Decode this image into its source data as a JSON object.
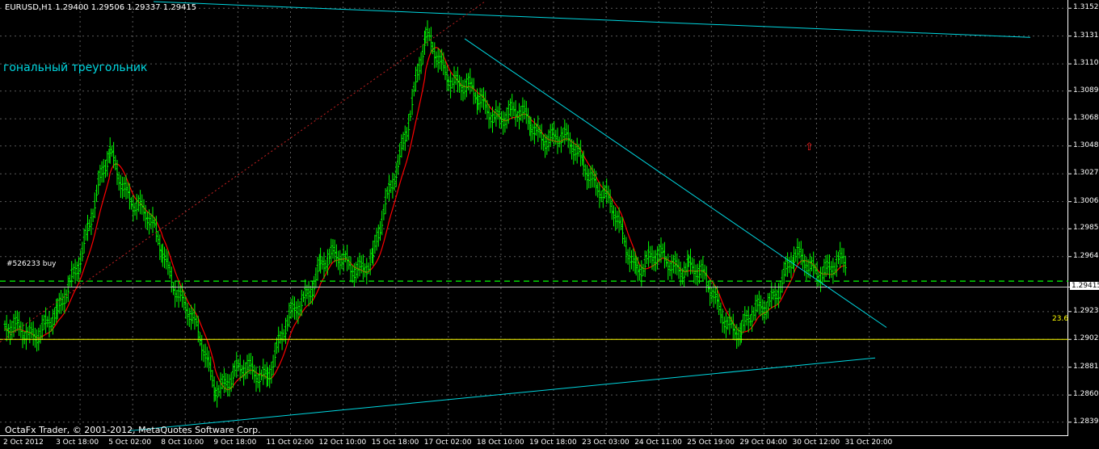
{
  "header": {
    "symbol_info": "EURUSD,H1  1.29400 1.29506 1.29337 1.29415"
  },
  "object_text": "гональный треугольник",
  "order_label": "#526233 buy",
  "fib_label": "23.6",
  "copyright": "OctaFx Trader, © 2001-2012, MetaQuotes Software Corp.",
  "y_axis": {
    "labels": [
      "1.31520",
      "1.31310",
      "1.31100",
      "1.30895",
      "1.30685",
      "1.30480",
      "1.30270",
      "1.30060",
      "1.29855",
      "1.29645",
      "1.29415",
      "1.29230",
      "1.29020",
      "1.28810",
      "1.28600",
      "1.28395"
    ],
    "current_price": "1.29415"
  },
  "x_axis": {
    "labels": [
      "2 Oct 2012",
      "3 Oct 18:00",
      "5 Oct 02:00",
      "8 Oct 10:00",
      "9 Oct 18:00",
      "11 Oct 02:00",
      "12 Oct 10:00",
      "15 Oct 18:00",
      "17 Oct 02:00",
      "18 Oct 10:00",
      "19 Oct 18:00",
      "23 Oct 03:00",
      "24 Oct 11:00",
      "25 Oct 19:00",
      "29 Oct 04:00",
      "30 Oct 12:00",
      "31 Oct 20:00"
    ]
  },
  "colors": {
    "background": "#000000",
    "bars": "#00ff00",
    "moving_average": "#ff0000",
    "trendline": "#00d7e0",
    "fib_level": "#ffff00",
    "order_level": "#00ff00",
    "grid": "#5a5a5a"
  },
  "chart_data": {
    "type": "ohlc",
    "symbol": "EURUSD",
    "timeframe": "H1",
    "price_points": [
      [
        "2 Oct 2012",
        1.2905
      ],
      [
        "3 Oct 18:00",
        1.2915
      ],
      [
        "5 Oct 02:00",
        1.304
      ],
      [
        "8 Oct 10:00",
        1.297
      ],
      [
        "9 Oct 18:00",
        1.287
      ],
      [
        "11 Oct 02:00",
        1.288
      ],
      [
        "12 Oct 10:00",
        1.296
      ],
      [
        "15 Oct 18:00",
        1.296
      ],
      [
        "17 Oct 02:00",
        1.3125
      ],
      [
        "18 Oct 10:00",
        1.308
      ],
      [
        "19 Oct 18:00",
        1.3065
      ],
      [
        "23 Oct 03:00",
        1.304
      ],
      [
        "24 Oct 11:00",
        1.296
      ],
      [
        "25 Oct 19:00",
        1.296
      ],
      [
        "29 Oct 04:00",
        1.2905
      ],
      [
        "30 Oct 12:00",
        1.296
      ],
      [
        "31 Oct 20:00",
        1.2955
      ]
    ],
    "ylim": [
      1.2829,
      1.3157
    ],
    "current_price": 1.29415,
    "order_level": 1.2946,
    "fib_23_6": 1.2902,
    "grid": true
  }
}
